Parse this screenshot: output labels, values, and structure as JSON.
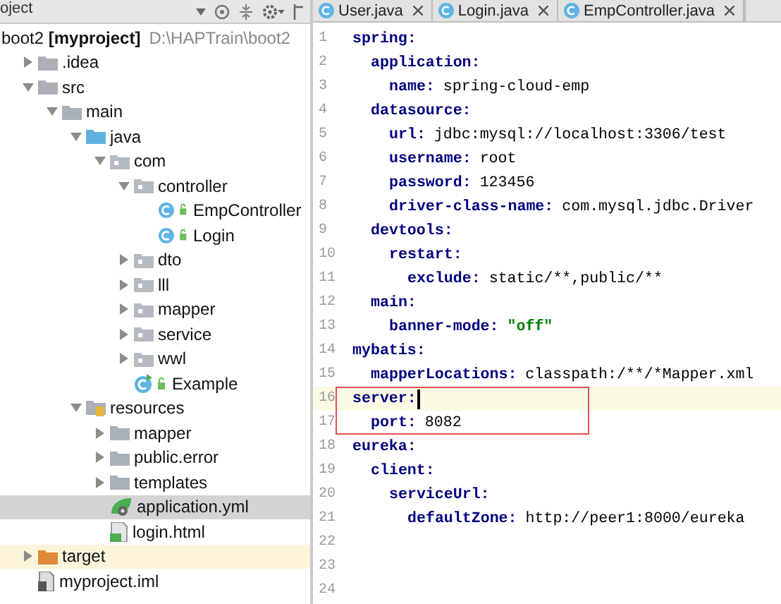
{
  "project_panel": {
    "title": "oject",
    "root": {
      "label": "boot2 **[myproject]**",
      "path": "D:\\HAPTrain\\boot2"
    },
    "items": [
      {
        "label": ".idea",
        "kind": "folder",
        "expanded": false,
        "selected": false
      },
      {
        "label": "src",
        "kind": "folder",
        "expanded": true,
        "selected": false,
        "children": [
          {
            "label": "main",
            "kind": "folder",
            "expanded": true,
            "selected": false,
            "children": [
              {
                "label": "java",
                "kind": "source",
                "expanded": true,
                "selected": false,
                "children": [
                  {
                    "label": "com",
                    "kind": "package",
                    "expanded": true,
                    "selected": false,
                    "children": [
                      {
                        "label": "controller",
                        "kind": "package",
                        "expanded": true,
                        "selected": false,
                        "children": [
                          {
                            "label": "EmpController",
                            "kind": "class",
                            "selected": false
                          },
                          {
                            "label": "Login",
                            "kind": "class",
                            "selected": false
                          }
                        ]
                      },
                      {
                        "label": "dto",
                        "kind": "package",
                        "expanded": false,
                        "selected": false
                      },
                      {
                        "label": "lll",
                        "kind": "package",
                        "expanded": false,
                        "selected": false
                      },
                      {
                        "label": "mapper",
                        "kind": "package",
                        "expanded": false,
                        "selected": false
                      },
                      {
                        "label": "service",
                        "kind": "package",
                        "expanded": false,
                        "selected": false
                      },
                      {
                        "label": "wwl",
                        "kind": "package",
                        "expanded": false,
                        "selected": false
                      },
                      {
                        "label": "Example",
                        "kind": "runnable",
                        "selected": false
                      }
                    ]
                  }
                ]
              },
              {
                "label": "resources",
                "kind": "resources",
                "expanded": true,
                "selected": false,
                "children": [
                  {
                    "label": "mapper",
                    "kind": "folder",
                    "expanded": false,
                    "selected": false
                  },
                  {
                    "label": "public.error",
                    "kind": "folder",
                    "expanded": false,
                    "selected": false
                  },
                  {
                    "label": "templates",
                    "kind": "folder",
                    "expanded": false,
                    "selected": false
                  },
                  {
                    "label": "application.yml",
                    "kind": "spring",
                    "selected": true
                  },
                  {
                    "label": "login.html",
                    "kind": "html",
                    "selected": false
                  }
                ]
              }
            ]
          }
        ]
      },
      {
        "label": "target",
        "kind": "excluded",
        "expanded": false,
        "selected": false
      },
      {
        "label": "myproject.iml",
        "kind": "iml",
        "selected": false
      }
    ]
  },
  "tabs": [
    {
      "label": "User.java",
      "selected": false
    },
    {
      "label": "Login.java",
      "selected": false
    },
    {
      "label": "EmpController.java",
      "selected": false
    }
  ],
  "editor": {
    "lines": [
      {
        "line": "1",
        "key": "spring:",
        "children": [
          {
            "line": "2",
            "key": "application:",
            "children": [
              {
                "line": "3",
                "key": "name:",
                "value": "spring-cloud-emp",
                "kind": "plain"
              }
            ]
          },
          {
            "line": "4",
            "key": "datasource:",
            "children": [
              {
                "line": "5",
                "key": "url:",
                "value": "jdbc:mysql://localhost:3306/test",
                "kind": "plain"
              },
              {
                "line": "6",
                "key": "username:",
                "value": "root",
                "kind": "plain"
              },
              {
                "line": "7",
                "key": "password:",
                "value": "123456",
                "kind": "plain"
              },
              {
                "line": "8",
                "key": "driver-class-name:",
                "value": "com.mysql.jdbc.Driver",
                "kind": "plain"
              }
            ]
          },
          {
            "line": "9",
            "key": "devtools:",
            "children": [
              {
                "line": "10",
                "key": "restart:",
                "children": [
                  {
                    "line": "11",
                    "key": "exclude:",
                    "value": "static/**,public/**",
                    "kind": "plain"
                  }
                ]
              }
            ]
          },
          {
            "line": "12",
            "key": "main:",
            "children": [
              {
                "line": "13",
                "key": "banner-mode:",
                "value": "\"off\"",
                "kind": "quoted"
              }
            ]
          }
        ]
      },
      {
        "line": "14",
        "key": "mybatis:",
        "children": [
          {
            "line": "15",
            "key": "mapperLocations:",
            "value": "classpath:/**/*Mapper.xml",
            "kind": "plain"
          }
        ]
      },
      {
        "line": "16",
        "key": "server:",
        "current": true,
        "boxed": true,
        "children": [
          {
            "line": "17",
            "key": "port:",
            "value": "8082",
            "kind": "plain"
          }
        ]
      },
      {
        "line": "18",
        "key": "eureka:",
        "children": [
          {
            "line": "19",
            "key": "client:",
            "children": [
              {
                "line": "20",
                "key": "serviceUrl:",
                "children": [
                  {
                    "line": "21",
                    "key": "defaultZone:",
                    "value": "http://peer1:8000/eureka",
                    "kind": "plain"
                  }
                ]
              }
            ]
          }
        ]
      }
    ],
    "empty_lines": [
      "22",
      "23",
      "24"
    ]
  }
}
